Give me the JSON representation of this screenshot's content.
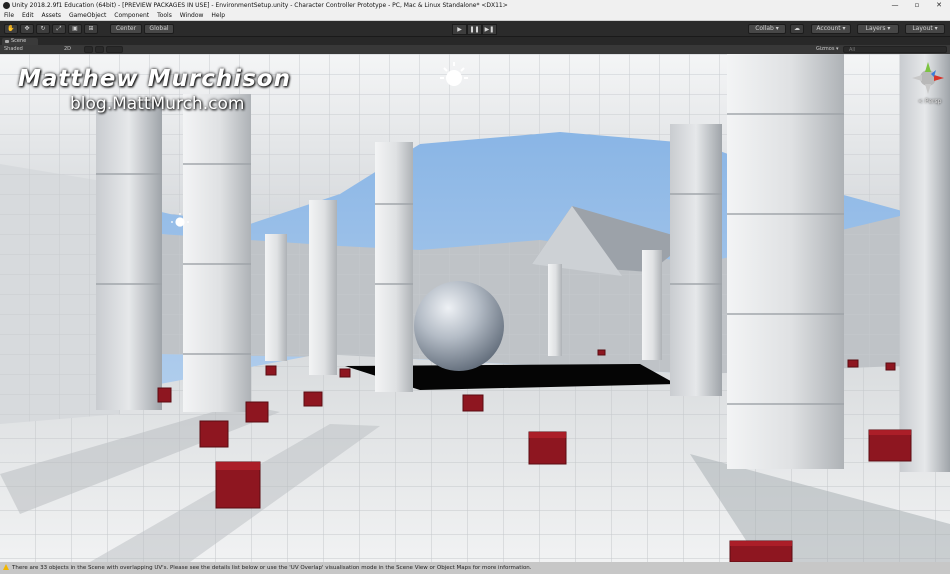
{
  "window": {
    "title": "Unity 2018.2.9f1 Education (64bit) - [PREVIEW PACKAGES IN USE] - EnvironmentSetup.unity - Character Controller Prototype - PC, Mac & Linux Standalone* <DX11>",
    "minimize": "—",
    "maximize": "▫",
    "close": "✕"
  },
  "menu": [
    "File",
    "Edit",
    "Assets",
    "GameObject",
    "Component",
    "Tools",
    "Window",
    "Help"
  ],
  "toolbar": {
    "pivot_label": "Center",
    "space_label": "Global",
    "play": "▶",
    "pause": "❚❚",
    "step": "▶❚",
    "collab_label": "Collab ▾",
    "cloud_icon": "cloud-icon",
    "account_label": "Account ▾",
    "layers_label": "Layers ▾",
    "layout_label": "Layout ▾"
  },
  "scene_tab": {
    "label": "Scene"
  },
  "scene_toolbar": {
    "shading_mode": "Shaded",
    "mode_2d": "2D",
    "gizmos_label": "Gizmos ▾",
    "search_placeholder": "All"
  },
  "watermark": {
    "name": "Matthew Murchison",
    "url": "blog.MattMurch.com"
  },
  "gizmo": {
    "projection": "< Persp"
  },
  "status": {
    "message": "There are 33 objects in the Scene with overlapping UV's. Please see the details list below or use the 'UV Overlap' visualisation mode in the Scene View or Object Maps for more information."
  },
  "colors": {
    "editor_dark": "#2b2b2b",
    "title_bar": "#f0f0f0",
    "sky": "#9fc4ec",
    "cube_red": "#8e1620",
    "warning": "#f2b600"
  }
}
